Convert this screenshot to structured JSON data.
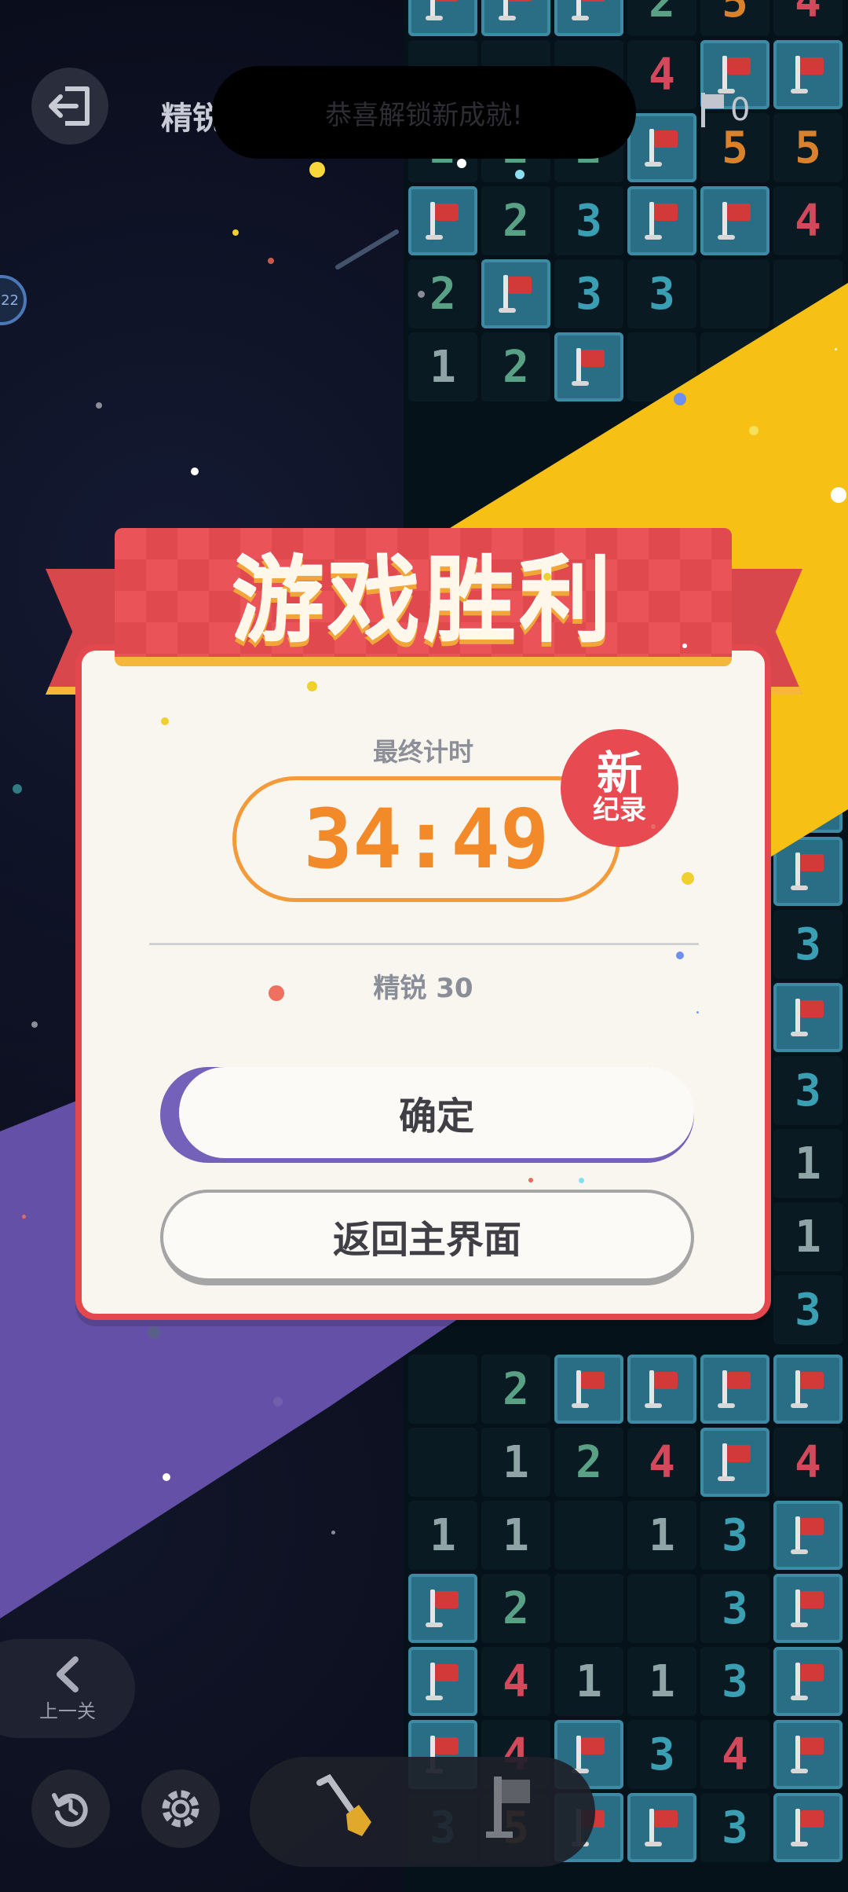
{
  "topbar": {
    "title": "精锐",
    "toast": "恭喜解锁新成就!",
    "flag_count": "0",
    "level_badge": "22"
  },
  "board": {
    "rows": [
      [
        "f",
        "f",
        "f",
        "2",
        "5",
        "4"
      ],
      [
        "",
        "",
        "",
        "4",
        "f",
        "f"
      ],
      [
        "2",
        "2",
        "2",
        "f",
        "5",
        "5"
      ],
      [
        "f",
        "2",
        "3",
        "f",
        "f",
        "4"
      ],
      [
        "2",
        "f",
        "3",
        "3",
        "",
        ""
      ],
      [
        "1",
        "2",
        "f",
        "",
        "",
        ""
      ]
    ],
    "right_column": [
      "f",
      "f",
      "3",
      "f",
      "3",
      "1",
      "1",
      "3"
    ],
    "bottom_rows": [
      [
        "",
        "2",
        "f",
        "f",
        "f",
        "f"
      ],
      [
        "",
        "1",
        "2",
        "4",
        "f",
        "4"
      ],
      [
        "1",
        "1",
        "",
        "1",
        "3",
        "f"
      ],
      [
        "f",
        "2",
        "",
        "",
        "3",
        "f"
      ],
      [
        "f",
        "4",
        "1",
        "1",
        "3",
        "f"
      ],
      [
        "f",
        "4",
        "f",
        "3",
        "4",
        "f"
      ],
      [
        "3",
        "5",
        "f",
        "f",
        "3",
        "f"
      ]
    ]
  },
  "dialog": {
    "title": "游戏胜利",
    "time_label": "最终计时",
    "time_value": "34:49",
    "new_record_big": "新",
    "new_record_small": "纪录",
    "mode": "精锐 30",
    "confirm": "确定",
    "home": "返回主界面"
  },
  "bottombar": {
    "prev_level": "上一关"
  },
  "colors": {
    "accent_red": "#e2484d",
    "accent_orange": "#f28a2a",
    "accent_purple": "#7462ba",
    "ribbon_gold": "#f4b73c"
  },
  "icons": [
    "exit-icon",
    "flag-icon",
    "chevron-left-icon",
    "restart-icon",
    "gear-icon",
    "shovel-icon",
    "flag-tool-icon"
  ]
}
